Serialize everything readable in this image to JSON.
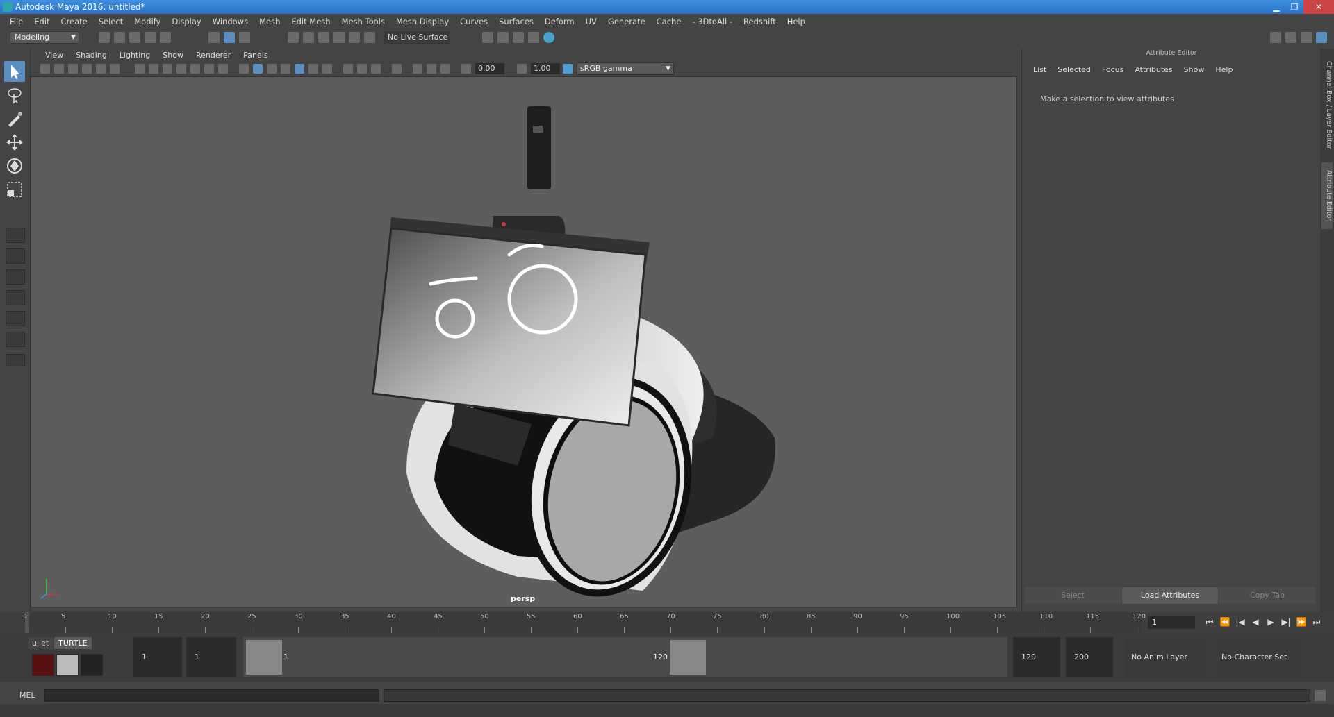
{
  "window": {
    "title": "Autodesk Maya 2016: untitled*",
    "minimize": "▁",
    "maximize": "❐",
    "close": "✕"
  },
  "menubar": [
    "File",
    "Edit",
    "Create",
    "Select",
    "Modify",
    "Display",
    "Windows",
    "Mesh",
    "Edit Mesh",
    "Mesh Tools",
    "Mesh Display",
    "Curves",
    "Surfaces",
    "Deform",
    "UV",
    "Generate",
    "Cache",
    "- 3DtoAll -",
    "Redshift",
    "Help"
  ],
  "toolbar": {
    "mode": "Modeling",
    "live_surface": "No Live Surface"
  },
  "viewport": {
    "menu": [
      "View",
      "Shading",
      "Lighting",
      "Show",
      "Renderer",
      "Panels"
    ],
    "exposure": "0.00",
    "gamma": "1.00",
    "color_space": "sRGB gamma",
    "camera": "persp"
  },
  "attribute_editor": {
    "header": "Attribute Editor",
    "menu": [
      "List",
      "Selected",
      "Focus",
      "Attributes",
      "Show",
      "Help"
    ],
    "message": "Make a selection to view attributes",
    "buttons": [
      "Select",
      "Load Attributes",
      "Copy Tab"
    ],
    "side_tabs": [
      "Channel Box / Layer Editor",
      "Attribute Editor"
    ]
  },
  "timeline": {
    "ticks": [
      "1",
      "5",
      "10",
      "15",
      "20",
      "25",
      "30",
      "35",
      "40",
      "45",
      "50",
      "55",
      "60",
      "65",
      "70",
      "75",
      "80",
      "85",
      "90",
      "95",
      "100",
      "105",
      "110",
      "115",
      "120"
    ],
    "current_frame": "1"
  },
  "range": {
    "shelf_tabs": [
      "ullet",
      "TURTLE"
    ],
    "start_time": "1",
    "playback_start": "1",
    "range_start_label": "1",
    "range_end_label": "120",
    "playback_end": "120",
    "end_time": "200",
    "anim_layer": "No Anim Layer",
    "character_set": "No Character Set"
  },
  "command_line": {
    "label": "MEL"
  }
}
